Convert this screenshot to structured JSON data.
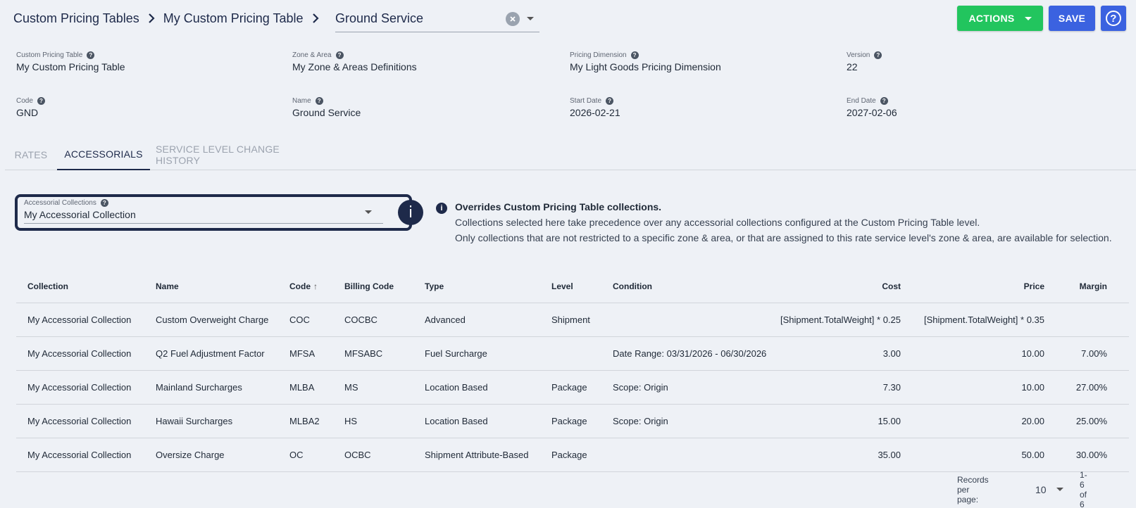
{
  "breadcrumb": {
    "items": [
      "Custom Pricing Tables",
      "My Custom Pricing Table"
    ],
    "service_value": "Ground Service"
  },
  "toolbar": {
    "actions_label": "ACTIONS",
    "save_label": "SAVE",
    "help_label": "?"
  },
  "details": {
    "custom_pricing_table": {
      "label": "Custom Pricing Table",
      "value": "My Custom Pricing Table"
    },
    "zone_area": {
      "label": "Zone & Area",
      "value": "My Zone & Areas Definitions"
    },
    "pricing_dimension": {
      "label": "Pricing Dimension",
      "value": "My Light Goods Pricing Dimension"
    },
    "version": {
      "label": "Version",
      "value": "22"
    },
    "code": {
      "label": "Code",
      "value": "GND"
    },
    "name": {
      "label": "Name",
      "value": "Ground Service"
    },
    "start_date": {
      "label": "Start Date",
      "value": "2026-02-21"
    },
    "end_date": {
      "label": "End Date",
      "value": "2027-02-06"
    }
  },
  "tabs": [
    {
      "label": "RATES",
      "active": false
    },
    {
      "label": "ACCESSORIALS",
      "active": true
    },
    {
      "label": "SERVICE LEVEL CHANGE HISTORY",
      "active": false
    }
  ],
  "accessorial": {
    "label": "Accessorial Collections",
    "value": "My Accessorial Collection"
  },
  "note": {
    "title": "Overrides Custom Pricing Table collections.",
    "lines": [
      "Collections selected here take precedence over any accessorial collections configured at the Custom Pricing Table level.",
      "Only collections that are not restricted to a specific zone & area, or that are assigned to this rate service level's zone & area, are available for selection."
    ]
  },
  "table": {
    "headers": {
      "collection": "Collection",
      "name": "Name",
      "code": "Code",
      "billing_code": "Billing Code",
      "type": "Type",
      "level": "Level",
      "condition": "Condition",
      "cost": "Cost",
      "price": "Price",
      "margin": "Margin"
    },
    "rows": [
      {
        "collection": "My Accessorial Collection",
        "name": "Custom Overweight Charge",
        "code": "COC",
        "billing_code": "COCBC",
        "type": "Advanced",
        "level": "Shipment",
        "condition": "",
        "cost": "[Shipment.TotalWeight] * 0.25",
        "price": "[Shipment.TotalWeight] * 0.35",
        "margin": ""
      },
      {
        "collection": "My Accessorial Collection",
        "name": "Q2 Fuel Adjustment Factor",
        "code": "MFSA",
        "billing_code": "MFSABC",
        "type": "Fuel Surcharge",
        "level": "",
        "condition": "Date Range: 03/31/2026 - 06/30/2026",
        "cost": "3.00",
        "price": "10.00",
        "margin": "7.00%"
      },
      {
        "collection": "My Accessorial Collection",
        "name": "Mainland Surcharges",
        "code": "MLBA",
        "billing_code": "MS",
        "type": "Location Based",
        "level": "Package",
        "condition": "Scope: Origin",
        "cost": "7.30",
        "price": "10.00",
        "margin": "27.00%"
      },
      {
        "collection": "My Accessorial Collection",
        "name": "Hawaii Surcharges",
        "code": "MLBA2",
        "billing_code": "HS",
        "type": "Location Based",
        "level": "Package",
        "condition": "Scope: Origin",
        "cost": "15.00",
        "price": "20.00",
        "margin": "25.00%"
      },
      {
        "collection": "My Accessorial Collection",
        "name": "Oversize Charge",
        "code": "OC",
        "billing_code": "OCBC",
        "type": "Shipment Attribute-Based",
        "level": "Package",
        "condition": "",
        "cost": "35.00",
        "price": "50.00",
        "margin": "30.00%"
      }
    ]
  },
  "pagination": {
    "records_per_page_label": "Records per page:",
    "records_per_page_value": "10",
    "range": "1-6 of 6"
  }
}
